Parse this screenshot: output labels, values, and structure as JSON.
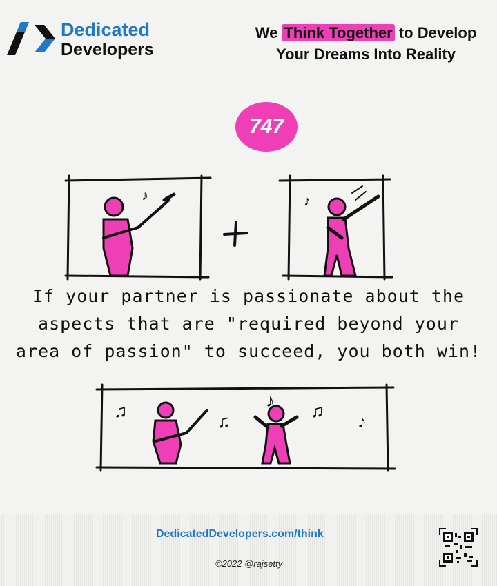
{
  "header": {
    "brand_line1": "Dedicated",
    "brand_line2": "Developers",
    "tagline_pre": "We ",
    "tagline_highlight": "Think Together",
    "tagline_post": " to Develop",
    "tagline_line2": "Your Dreams Into Reality"
  },
  "badge": {
    "number": "747"
  },
  "quote": {
    "text": "If your partner is passionate about the aspects that are \"required beyond your area of passion\" to succeed, you both win!"
  },
  "footer": {
    "url": "DedicatedDevelopers.com/think",
    "copyright": "©2022 @rajsetty"
  },
  "colors": {
    "accent": "#ee3fb6",
    "brand_blue": "#1f78c8"
  }
}
